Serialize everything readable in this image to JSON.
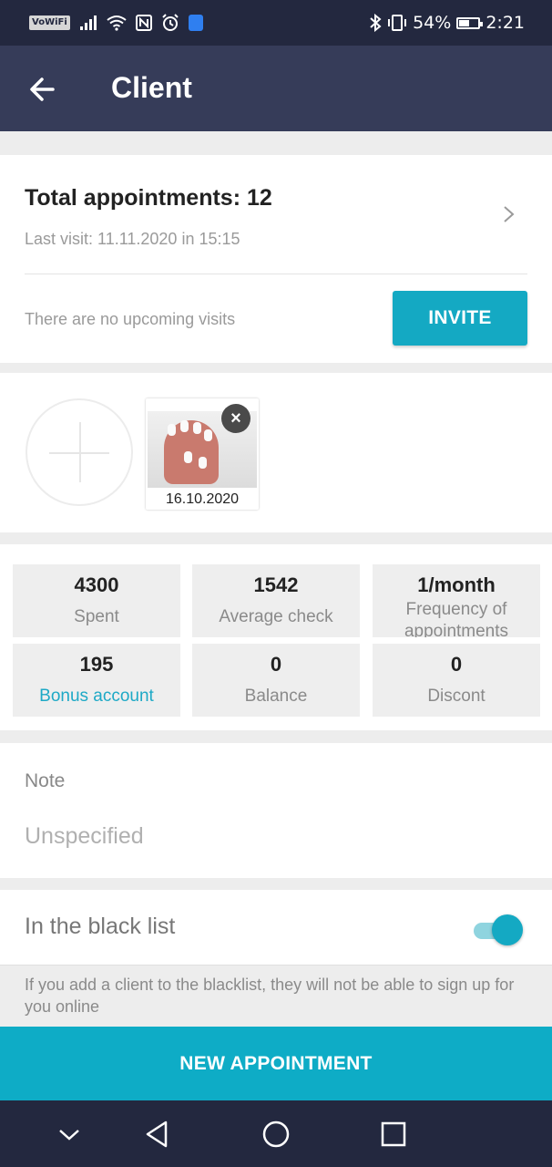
{
  "status_bar": {
    "carrier_badge": "VoWiFi",
    "battery": "54%",
    "battery_level": 0.54,
    "time": "2:21",
    "icons": [
      "signal-icon",
      "wifi-icon",
      "nfc-icon",
      "alarm-icon",
      "shield-icon",
      "bluetooth-icon",
      "vibrate-icon",
      "battery-icon"
    ]
  },
  "header": {
    "title": "Client",
    "back_icon": "arrow-left-icon"
  },
  "appointments": {
    "total": "Total appointments: 12",
    "last_visit": "Last visit: 11.11.2020 in 15:15",
    "upcoming": "There are no upcoming visits",
    "invite_label": "INVITE"
  },
  "photos": {
    "items": [
      {
        "date": "16.10.2020"
      }
    ]
  },
  "stats": [
    {
      "value": "4300",
      "label": "Spent"
    },
    {
      "value": "1542",
      "label": "Average check"
    },
    {
      "value": "1/month",
      "label": "Frequency of appointments"
    },
    {
      "value": "195",
      "label": "Bonus account"
    },
    {
      "value": "0",
      "label": "Balance"
    },
    {
      "value": "0",
      "label": "Discont"
    }
  ],
  "note": {
    "label": "Note",
    "value": "Unspecified"
  },
  "blacklist": {
    "label": "In the black list",
    "enabled": true,
    "hint": "If you add a client to the blacklist, they will not be able to sign up for you online"
  },
  "new_appointment_label": "NEW APPOINTMENT",
  "colors": {
    "header_bg": "#363c59",
    "status_bg": "#23283f",
    "accent": "#0eacc6",
    "link": "#1ea9c6"
  }
}
